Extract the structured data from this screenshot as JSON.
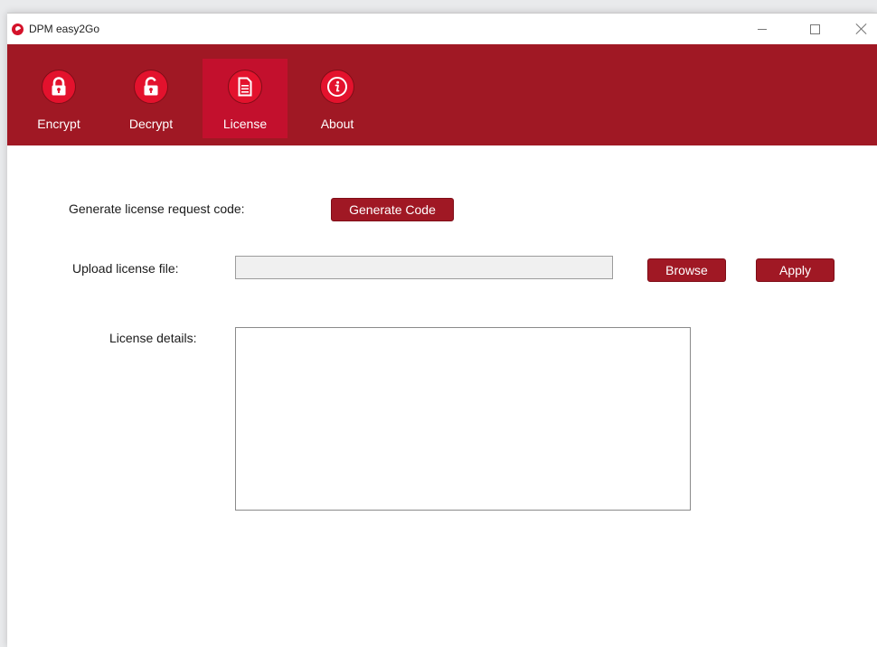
{
  "window": {
    "title": "DPM easy2Go"
  },
  "toolbar": {
    "items": [
      {
        "label": "Encrypt",
        "icon": "lock-icon"
      },
      {
        "label": "Decrypt",
        "icon": "unlock-icon"
      },
      {
        "label": "License",
        "icon": "document-icon",
        "active": true
      },
      {
        "label": "About",
        "icon": "info-icon"
      }
    ]
  },
  "license": {
    "generate_label": "Generate license request code:",
    "generate_button": "Generate Code",
    "upload_label": "Upload license file:",
    "upload_value": "",
    "browse_button": "Browse",
    "apply_button": "Apply",
    "details_label": "License details:",
    "details_value": ""
  },
  "colors": {
    "brand": "#a01824",
    "active_tab": "#c3102d",
    "icon_fill": "#e3122d"
  }
}
